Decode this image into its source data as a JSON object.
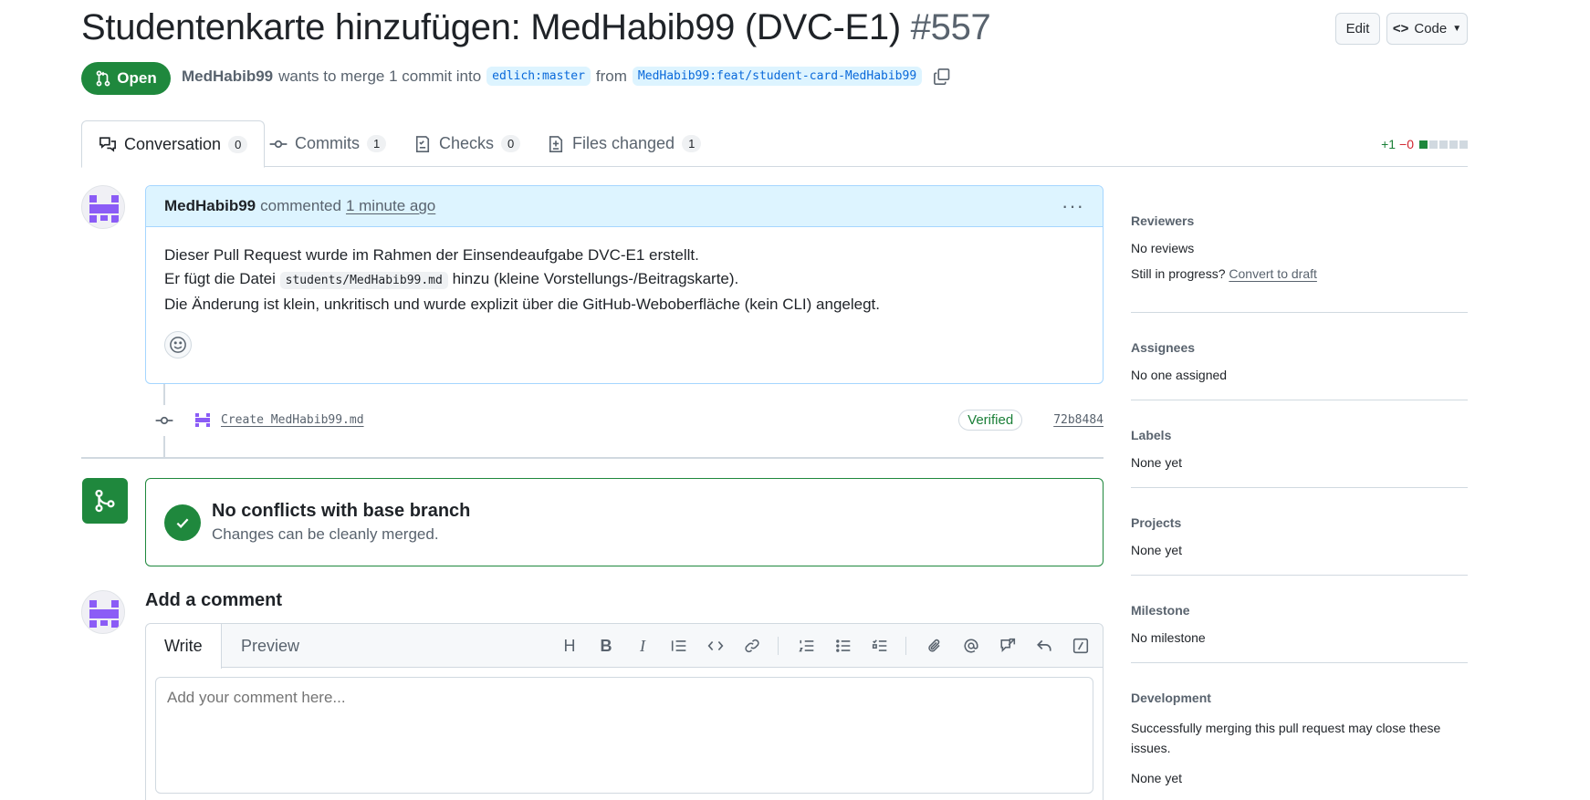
{
  "header": {
    "title": "Studentenkarte hinzufügen: MedHabib99 (DVC-E1)",
    "number": "#557",
    "edit_label": "Edit",
    "code_label": "Code"
  },
  "pr_meta": {
    "state": "Open",
    "author": "MedHabib99",
    "text_middle": "wants to merge 1 commit into",
    "base_branch": "edlich:master",
    "from_text": "from",
    "head_branch": "MedHabib99:feat/student-card-MedHabib99"
  },
  "tabs": [
    {
      "label": "Conversation",
      "count": "0"
    },
    {
      "label": "Commits",
      "count": "1"
    },
    {
      "label": "Checks",
      "count": "0"
    },
    {
      "label": "Files changed",
      "count": "1"
    }
  ],
  "diffstat": {
    "additions": "+1",
    "deletions": "−0"
  },
  "comment": {
    "author": "MedHabib99",
    "action": "commented",
    "time": "1 minute ago",
    "line1": "Dieser Pull Request wurde im Rahmen der Einsendeaufgabe DVC-E1 erstellt.",
    "line2_pre": "Er fügt die Datei",
    "line2_code": "students/MedHabib99.md",
    "line2_post": "hinzu (kleine Vorstellungs-/Beitragskarte).",
    "line3": "Die Änderung ist klein, unkritisch und wurde explizit über die GitHub-Weboberfläche (kein CLI) angelegt."
  },
  "commit": {
    "message": "Create MedHabib99.md",
    "verified": "Verified",
    "sha": "72b8484"
  },
  "merge": {
    "title": "No conflicts with base branch",
    "subtitle": "Changes can be cleanly merged."
  },
  "add_comment": {
    "title": "Add a comment",
    "write_tab": "Write",
    "preview_tab": "Preview",
    "placeholder": "Add your comment here..."
  },
  "sidebar": {
    "reviewers": {
      "heading": "Reviewers",
      "value": "No reviews",
      "progress_text": "Still in progress?",
      "draft_link": "Convert to draft"
    },
    "assignees": {
      "heading": "Assignees",
      "value": "No one assigned"
    },
    "labels": {
      "heading": "Labels",
      "value": "None yet"
    },
    "projects": {
      "heading": "Projects",
      "value": "None yet"
    },
    "milestone": {
      "heading": "Milestone",
      "value": "No milestone"
    },
    "development": {
      "heading": "Development",
      "desc": "Successfully merging this pull request may close these issues.",
      "value": "None yet"
    }
  },
  "colors": {
    "green": "#1f883d",
    "blue_bg": "#ddf4ff",
    "link": "#0969da",
    "avatar": "#8b5cf6"
  }
}
